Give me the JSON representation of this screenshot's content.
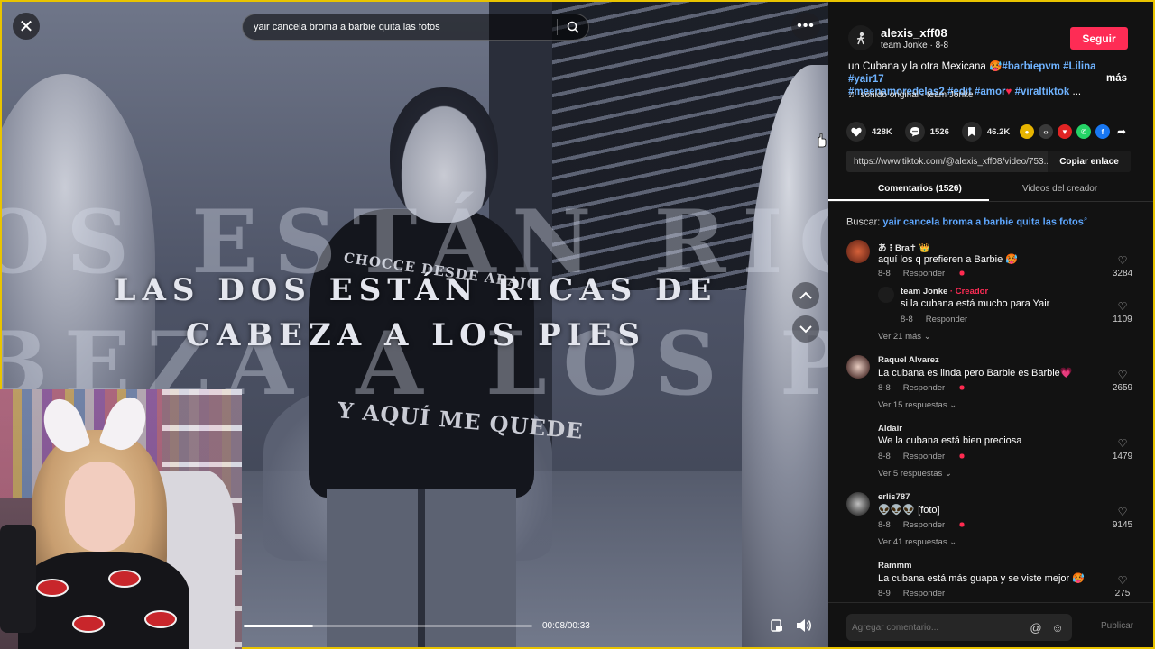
{
  "video": {
    "search_value": "yair cancela broma a barbie quita las fotos",
    "caption_line1": "LAS DOS ESTÁN RICAS DE",
    "caption_line2": "CABEZA A LOS PIES",
    "ghost_line1": "OS ESTÁN RIC",
    "ghost_line2": "BEZA A LOS P",
    "shirt_top": "CHOCCE DESDE ABAJO",
    "shirt_bottom": "Y AQUÍ ME QUEDE",
    "time": "00:08/00:33",
    "progress": 0.24,
    "icons": {
      "close": "close-icon",
      "search": "search-icon",
      "more": "more-dots-icon",
      "up": "chevron-up-icon",
      "down": "chevron-down-icon",
      "pip": "picture-in-picture-icon",
      "volume": "volume-icon"
    }
  },
  "author": {
    "username": "alexis_xff08",
    "subline": "team Jonke · 8-8",
    "follow_label": "Seguir"
  },
  "description": {
    "text_start": "un Cubana y la otra Mexicana 🥵",
    "tags_line1": [
      "#barbiepvm",
      "#Lilina",
      "#yair17"
    ],
    "tags_line2": [
      "#meenamoredelas2",
      "#edit",
      "#amor"
    ],
    "heart": "♥",
    "tag_last": "#viraltiktok",
    "ellipsis": "...",
    "more_label": "más"
  },
  "sound": {
    "icon": "music-note-icon",
    "label": "sonido original - team Jonke"
  },
  "stats": {
    "likes": "428K",
    "comments": "1526",
    "saves": "46.2K"
  },
  "share": {
    "colors": {
      "embed_coin": "#e6b400",
      "code": "#3a3a3a",
      "telegram": "#e02424",
      "whatsapp": "#25d366",
      "facebook": "#1877f2"
    }
  },
  "link": {
    "url": "https://www.tiktok.com/@alexis_xff08/video/753...",
    "copy_label": "Copiar enlace"
  },
  "tabs": {
    "comments": "Comentarios (1526)",
    "videos": "Videos del creador"
  },
  "search_hint": {
    "prefix": "Buscar:",
    "query": "yair cancela broma a barbie quita las fotos"
  },
  "comments": [
    {
      "name": "あ⋮Bra✝ 👑",
      "text": "aquí los q prefieren a Barbie 🥵",
      "date": "8-8",
      "reply": "Responder",
      "likes": "3284"
    },
    {
      "name": "team Jonke",
      "badge": "· Creador",
      "text": "si la cubana está mucho para Yair",
      "date": "8-8",
      "reply": "Responder",
      "likes": "1109"
    },
    {
      "view_more": "Ver 21 más"
    },
    {
      "name": "Raquel Alvarez",
      "text": "La cubana es linda pero Barbie es Barbie💗",
      "date": "8-8",
      "reply": "Responder",
      "likes": "2659",
      "view_more": "Ver 15 respuestas"
    },
    {
      "name": "Aldair",
      "text": "We la cubana está bien preciosa",
      "date": "8-8",
      "reply": "Responder",
      "likes": "1479",
      "view_more": "Ver 5 respuestas"
    },
    {
      "name": "erlis787",
      "text": "👽👽👽 [foto]",
      "date": "8-8",
      "reply": "Responder",
      "likes": "9145",
      "view_more": "Ver 41 respuestas"
    },
    {
      "name": "Rammm",
      "text": "La cubana está más guapa y se viste mejor 🥵",
      "date": "8-9",
      "reply": "Responder",
      "likes": "275"
    }
  ],
  "comment_bar": {
    "placeholder": "Agregar comentario...",
    "publish": "Publicar"
  }
}
